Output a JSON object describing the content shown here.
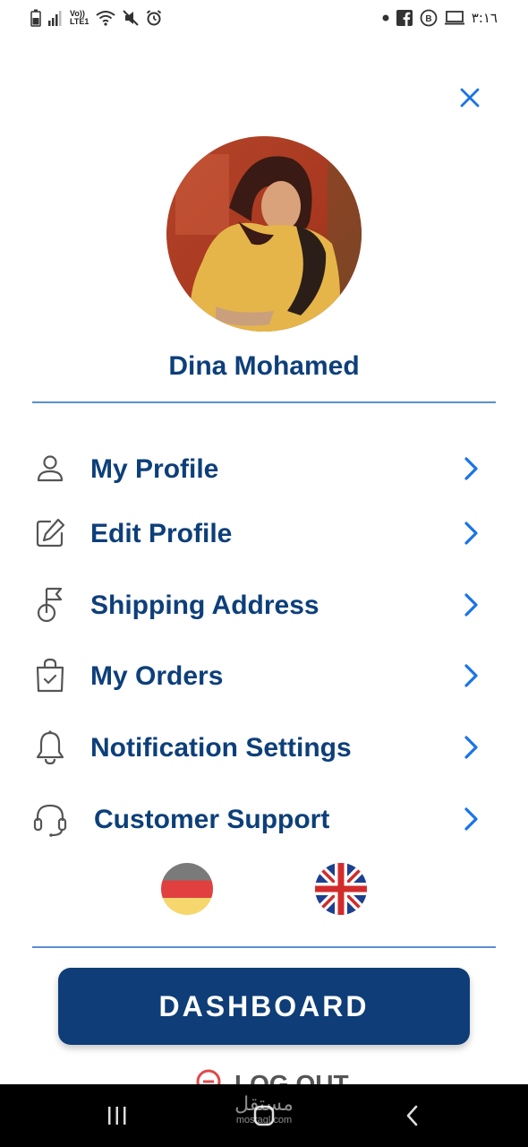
{
  "status_bar": {
    "network_top": "Vo))",
    "network_bottom": "LTE1",
    "time": "٣:١٦"
  },
  "profile": {
    "name": "Dina Mohamed"
  },
  "menu": {
    "items": [
      {
        "label": "My Profile",
        "icon": "person-icon"
      },
      {
        "label": "Edit Profile",
        "icon": "edit-icon"
      },
      {
        "label": "Shipping Address",
        "icon": "flag-pin-icon"
      },
      {
        "label": "My Orders",
        "icon": "shopping-bag-icon"
      },
      {
        "label": "Notification Settings",
        "icon": "bell-icon"
      },
      {
        "label": "Customer Support",
        "icon": "headset-icon"
      }
    ]
  },
  "languages": [
    {
      "icon": "germany-flag-icon"
    },
    {
      "icon": "uk-flag-icon"
    }
  ],
  "dashboard_label": "DASHBOARD",
  "logout_label": "LOG OUT",
  "watermark": {
    "main": "مستقل",
    "sub": "mostaql.com"
  },
  "colors": {
    "primary": "#0e3d78",
    "accent": "#1a73e8",
    "text": "#0d3f7a",
    "divider": "#5b8fd0"
  }
}
